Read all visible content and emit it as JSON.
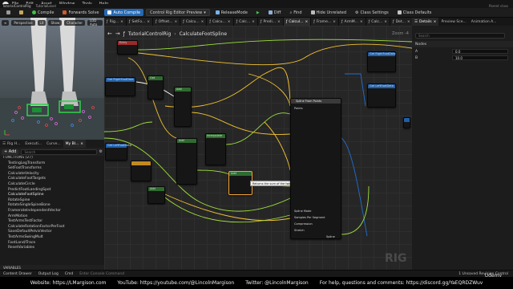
{
  "menubar": {
    "menus": [
      "File",
      "Edit",
      "Asset",
      "Window",
      "Tools",
      "Help"
    ],
    "doc_tab": "TutorialControlRig",
    "doc_tab2": "TutorialLevel",
    "right_text": "Parent class"
  },
  "toolbar": {
    "compile": "Compile",
    "forwards_solve": "Forwards Solve",
    "auto_compile": "Auto Compile",
    "preview": "Control Rig Editor Preview",
    "release_mode": "ReleaseMode",
    "diff": "Diff",
    "find": "Find",
    "hide_unrelated": "Hide Unrelated",
    "class_settings": "Class Settings",
    "class_defaults": "Class Defaults"
  },
  "viewport": {
    "buttons": [
      "Perspective",
      "Lit",
      "Show",
      "Character",
      "LOD Auto"
    ]
  },
  "left_tabs": [
    "Rig H...",
    "Executi...",
    "Curve...",
    "My Bl..."
  ],
  "left_tools": {
    "add": "+ Add",
    "search_placeholder": "Search"
  },
  "functions": [
    {
      "label": "FUNCTIONS (27)",
      "kind": "sub"
    },
    {
      "label": "TestingLegTransform",
      "kind": "item"
    },
    {
      "label": "SetFootTransforms",
      "kind": "item"
    },
    {
      "label": "CalculateVelocity",
      "kind": "item"
    },
    {
      "label": "CalculateFootTargets",
      "kind": "item"
    },
    {
      "label": "CalculateCircle",
      "kind": "item"
    },
    {
      "label": "PredictFootLandingSpot",
      "kind": "item"
    },
    {
      "label": "CalculateFootSpline",
      "kind": "hi"
    },
    {
      "label": "RotateSpine",
      "kind": "item"
    },
    {
      "label": "RotateSingleSpineBone",
      "kind": "item"
    },
    {
      "label": "FrameratelndependentVector",
      "kind": "item"
    },
    {
      "label": "ArmMotion",
      "kind": "item"
    },
    {
      "label": "TestArmsTestFactor",
      "kind": "item"
    },
    {
      "label": "CalculateRotationFactorPerFoot",
      "kind": "item"
    },
    {
      "label": "SaveDefaultPelvisVector",
      "kind": "item"
    },
    {
      "label": "TestArmsSwingMult",
      "kind": "item"
    },
    {
      "label": "FootLand/Trace",
      "kind": "item"
    },
    {
      "label": "ResetVariables",
      "kind": "item"
    }
  ],
  "variables_bar": "VARIABLES",
  "graph_tabs": [
    "Rig...",
    "SetFo...",
    "Offset...",
    "Calcu...",
    "Calcu...",
    "Calc...",
    "Predi...",
    "Calcul...",
    "Frame...",
    "ArmM...",
    "Calc...",
    "Det..."
  ],
  "graph": {
    "crumb_root": "TutorialControlRig",
    "crumb_current": "CalculateFootSpline",
    "zoom": "Zoom -4",
    "watermark": "RIG",
    "tooltip": "Returns the sum of the two values"
  },
  "nodes": {
    "spline_title": "Spline From Points",
    "entry_title": "Entry",
    "return_title": "Return",
    "get_title": "Get",
    "add_title": "Add",
    "interpolate_title": "Interpolate",
    "spline_pins": [
      "Points",
      "Spline Mode",
      "Samples Per Segment",
      "Compression",
      "Stretch",
      "Spline"
    ],
    "foot_get": "Get RightFootData",
    "foot_get2": "Get LeftFootData",
    "pin_labels": [
      "Start",
      "End",
      "Result",
      "A",
      "B",
      "T",
      "Value",
      "Add pin"
    ]
  },
  "details_tabs": [
    "Details",
    "Preview Sce...",
    "Animation A..."
  ],
  "details": {
    "search_placeholder": "Search",
    "section": "Nodes",
    "rows": [
      {
        "label": "A",
        "value": "0.0"
      },
      {
        "label": "B",
        "value": "10.0"
      }
    ]
  },
  "statusbar": {
    "items": [
      "Content Drawer",
      "Output Log",
      "Cmd",
      "Enter Console Command"
    ],
    "right": "1 Unsaved   Revision Control"
  },
  "footer": {
    "website": "Website: https://LMargison.com",
    "youtube": "YouTube: https://youtube.com/@LincolnMargison",
    "twitter": "Twitter: @LincolnMargison",
    "discord": "For help, questions and comments: https://discord.gg/YaEQRDZWuv"
  },
  "brand": "Udemy",
  "colors": {
    "accent": "#2469b3",
    "exec": "#ffffff",
    "float_wire": "#9fe03c",
    "vector_wire": "#f1c232",
    "struct_wire": "#1f6fd1",
    "node_body": "#161616",
    "graph_bg": "#262626"
  }
}
